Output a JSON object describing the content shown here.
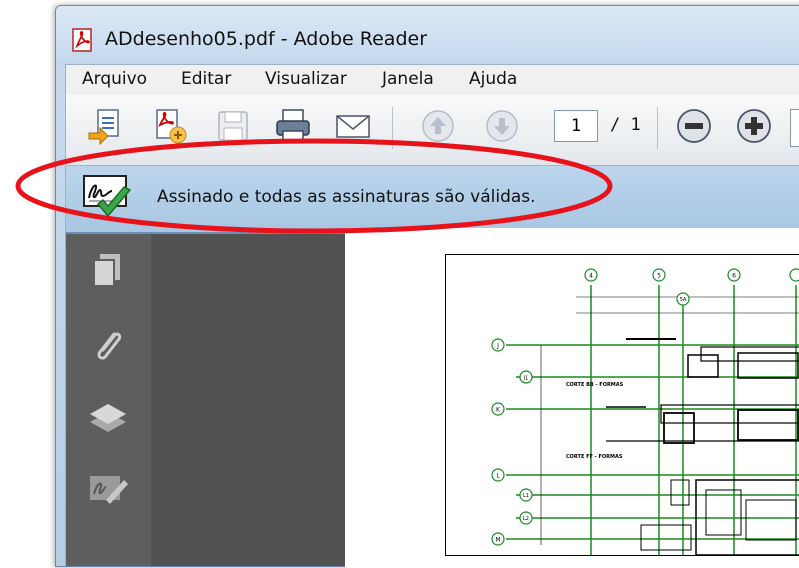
{
  "window": {
    "title": "ADdesenho05.pdf - Adobe Reader"
  },
  "menu": [
    "Arquivo",
    "Editar",
    "Visualizar",
    "Janela",
    "Ajuda"
  ],
  "toolbar": {
    "current_page": "1",
    "total_pages": "/ 1",
    "icons": [
      "create-pdf-icon",
      "export-icon",
      "save-icon",
      "print-icon",
      "email-icon",
      "previous-page-icon",
      "next-page-icon",
      "zoom-out-icon",
      "zoom-in-icon"
    ]
  },
  "signature_bar": {
    "message": "Assinado e todas as assinaturas são válidas."
  },
  "sidebar": {
    "icons": [
      "pages-icon",
      "attachments-icon",
      "layers-icon",
      "signatures-icon"
    ]
  },
  "drawing_labels": {
    "grid_top": [
      "4",
      "5",
      "6"
    ],
    "grid_5a": "5A",
    "grid_left": [
      "J",
      "J1",
      "K",
      "L",
      "L1",
      "L2",
      "M"
    ],
    "sections": [
      "CORTE BB - FORMAS",
      "CORTE FF - FORMAS"
    ]
  },
  "colors": {
    "annotation": "#e8121a",
    "grid": "#1a8a22",
    "signature_check": "#3aa64a"
  }
}
